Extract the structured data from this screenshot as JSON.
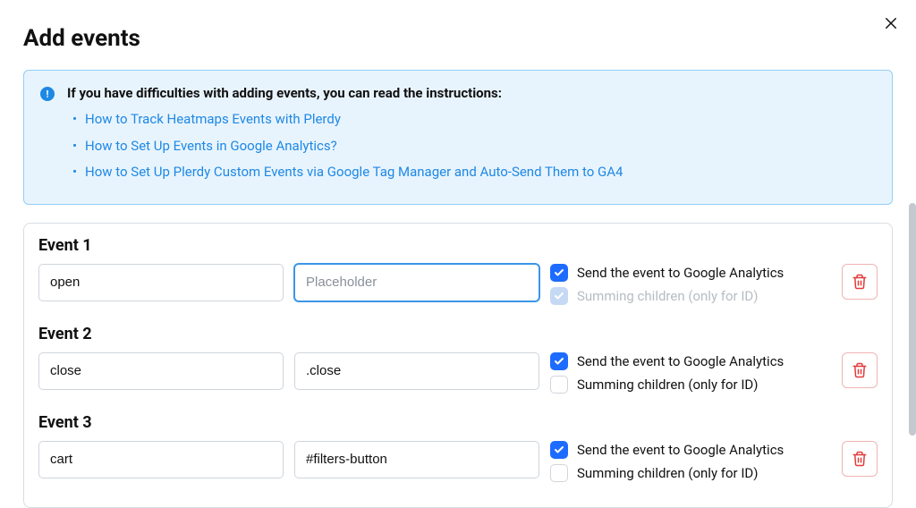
{
  "modal": {
    "title": "Add events"
  },
  "info": {
    "heading": "If you have difficulties with adding events, you can read the instructions:",
    "links": [
      "How to Track Heatmaps Events with Plerdy",
      "How to Set Up Events in Google Analytics?",
      "How to Set Up Plerdy Custom Events via Google Tag Manager and Auto-Send Them to GA4"
    ]
  },
  "labels": {
    "ga": "Send the event to Google Analytics",
    "sum": "Summing children (only for ID)",
    "selector_placeholder": "Placeholder"
  },
  "events": [
    {
      "title": "Event 1",
      "name": "open",
      "selector": "",
      "ga": true,
      "sum": true,
      "sum_disabled": true,
      "selector_focused": true
    },
    {
      "title": "Event 2",
      "name": "close",
      "selector": ".close",
      "ga": true,
      "sum": false,
      "sum_disabled": false,
      "selector_focused": false
    },
    {
      "title": "Event 3",
      "name": "cart",
      "selector": "#filters-button",
      "ga": true,
      "sum": false,
      "sum_disabled": false,
      "selector_focused": false
    }
  ]
}
